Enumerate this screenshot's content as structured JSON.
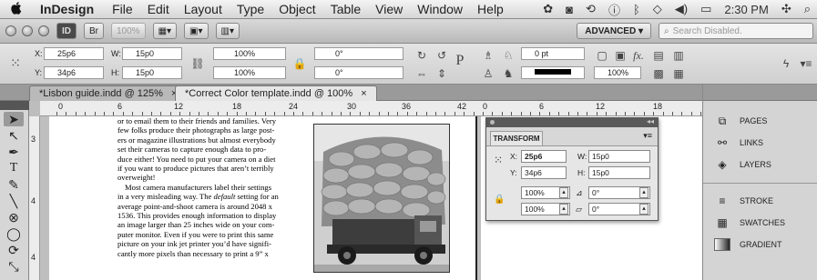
{
  "menubar": {
    "apple": "",
    "app_name": "InDesign",
    "items": [
      "File",
      "Edit",
      "Layout",
      "Type",
      "Object",
      "Table",
      "View",
      "Window",
      "Help"
    ],
    "time": "2:30 PM"
  },
  "appbar": {
    "id_label": "ID",
    "br_label": "Br",
    "zoom": "100%",
    "workspace": "ADVANCED ▾",
    "search_placeholder": "Search Disabled."
  },
  "control": {
    "x_label": "X:",
    "x_value": "25p6",
    "y_label": "Y:",
    "y_value": "34p6",
    "w_label": "W:",
    "w_value": "15p0",
    "h_label": "H:",
    "h_value": "15p0",
    "scale_x": "100%",
    "scale_y": "100%",
    "angle": "0°",
    "shear": "0°",
    "stroke_weight": "0 pt",
    "opacity": "100%",
    "fx_label": "fx."
  },
  "tabs": [
    {
      "label": "*Lisbon guide.indd @ 125%",
      "close": "×"
    },
    {
      "label": "*Correct Color template.indd @ 100%",
      "close": "×"
    }
  ],
  "ruler": {
    "labels": [
      "0",
      "6",
      "12",
      "18",
      "24",
      "30",
      "36",
      "42",
      "0",
      "6",
      "12",
      "18"
    ],
    "vlabels": [
      "3",
      "4",
      "4",
      "4"
    ]
  },
  "body_text": {
    "lines1": [
      "or to email them to their friends and families. Very",
      "few folks produce their photographs as large post-",
      "ers or magazine illustrations but almost everybody",
      "set their cameras to capture enough data to pro-",
      "duce either! You need to put your camera on a diet",
      "if you want to produce pictures that aren’t terribly",
      "overweight!"
    ],
    "para2_first": "Most camera manufacturers label their settings",
    "para2_line2a": "in a very misleading way. The ",
    "para2_italic": "default",
    "para2_line2b": " setting for an",
    "lines2": [
      "average point-and-shoot camera is around 2048 x",
      "1536. This provides enough information to display",
      "an image larger than 25 inches wide on your com-",
      "puter monitor. Even if you were to print this same",
      "picture on your ink jet printer you’d have signifi-",
      "cantly more pixels than necessary to print a 9” x"
    ]
  },
  "transform_panel": {
    "title": "TRANSFORM",
    "x_label": "X:",
    "x_value": "25p6",
    "y_label": "Y:",
    "y_value": "34p6",
    "w_label": "W:",
    "w_value": "15p0",
    "h_label": "H:",
    "h_value": "15p0",
    "sx": "100%",
    "sy": "100%",
    "rot": "0°",
    "shear": "0°"
  },
  "right_panel": {
    "items": [
      {
        "label": "PAGES",
        "icon": "pages-icon"
      },
      {
        "label": "LINKS",
        "icon": "links-icon"
      },
      {
        "label": "LAYERS",
        "icon": "layers-icon"
      },
      {
        "label": "STROKE",
        "icon": "stroke-icon"
      },
      {
        "label": "SWATCHES",
        "icon": "swatches-icon"
      },
      {
        "label": "GRADIENT",
        "icon": "gradient-icon"
      }
    ]
  }
}
